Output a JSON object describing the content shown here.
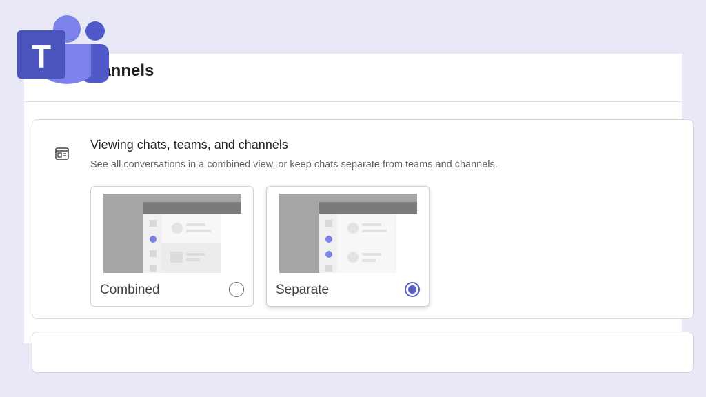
{
  "page": {
    "title": "d channels"
  },
  "section": {
    "icon": "chat-layout-icon",
    "heading": "Viewing chats, teams, and channels",
    "description": "See all conversations in a combined view, or keep chats separate from teams and channels."
  },
  "options": [
    {
      "label": "Combined",
      "selected": false
    },
    {
      "label": "Separate",
      "selected": true
    }
  ],
  "logo": {
    "letter": "T",
    "icon": "microsoft-teams-logo"
  },
  "colors": {
    "background": "#e8e8f7",
    "accent": "#5b5fc7",
    "logo_dark": "#4b53bc",
    "logo_light": "#7b83eb"
  }
}
